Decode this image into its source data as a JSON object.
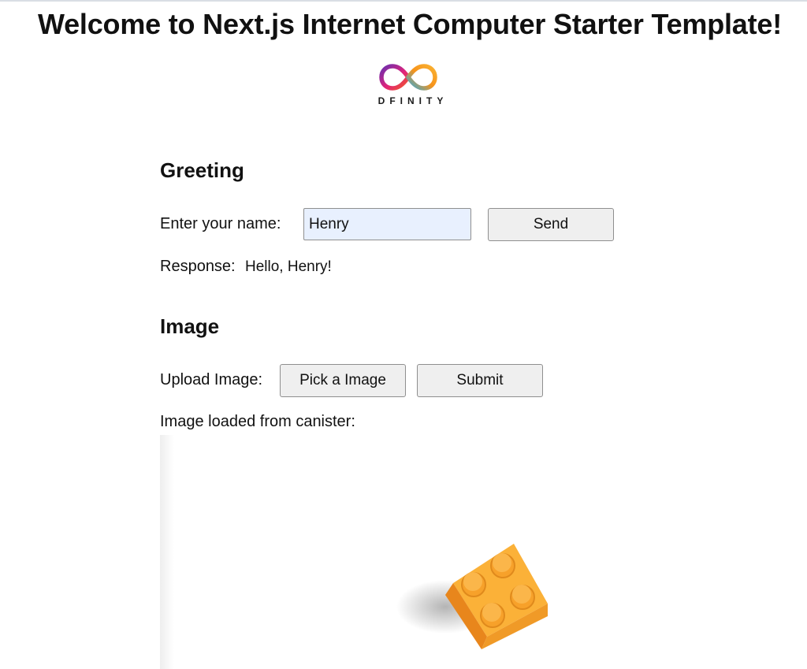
{
  "page": {
    "title": "Welcome to Next.js Internet Computer Starter Template!"
  },
  "logo": {
    "text": "DFINITY",
    "colors": {
      "purple": "#6a2fb0",
      "magenta": "#e0237a",
      "orange": "#f7931a",
      "blue": "#29abe2"
    }
  },
  "greeting": {
    "heading": "Greeting",
    "name_label": "Enter your name:",
    "name_value": "Henry",
    "send_label": "Send",
    "response_label": "Response:",
    "response_value": "Hello, Henry!"
  },
  "image_section": {
    "heading": "Image",
    "upload_label": "Upload Image:",
    "pick_label": "Pick a Image",
    "submit_label": "Submit",
    "loaded_label": "Image loaded from canister:",
    "brick_color": "#f7a12a"
  },
  "colors": {
    "input_autofill_bg": "#e8f0fe",
    "button_bg": "#efefef"
  }
}
